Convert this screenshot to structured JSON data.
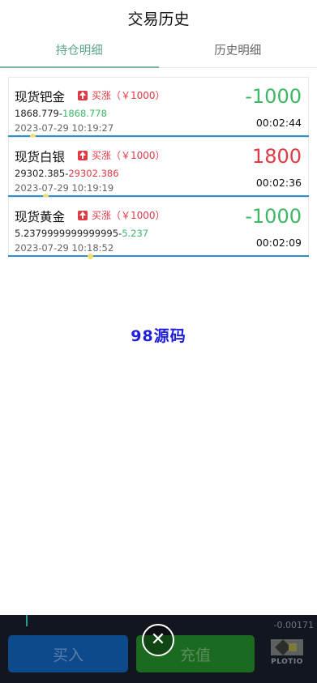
{
  "header": {
    "title": "交易历史"
  },
  "tabs": [
    {
      "label": "持仓明细",
      "active": true
    },
    {
      "label": "历史明细",
      "active": false
    }
  ],
  "trades": [
    {
      "name": "现货钯金",
      "badge": "买涨（￥1000）",
      "open_price": "1868.779-",
      "current_price": "1868.778",
      "current_color": "green",
      "time": "2023-07-29 10:19:27",
      "pl": "-1000",
      "pl_color": "green",
      "duration": "00:02:44"
    },
    {
      "name": "现货白银",
      "badge": "买涨（￥1000）",
      "open_price": "29302.385-",
      "current_price": "29302.386",
      "current_color": "red",
      "time": "2023-07-29 10:19:19",
      "pl": "1800",
      "pl_color": "red",
      "duration": "00:02:36"
    },
    {
      "name": "现货黄金",
      "badge": "买涨（￥1000）",
      "open_price": "5.2379999999999995-",
      "current_price": "5.237",
      "current_color": "green",
      "time": "2023-07-29 10:18:52",
      "pl": "-1000",
      "pl_color": "green",
      "duration": "00:02:09"
    }
  ],
  "watermark": "98源码",
  "footer": {
    "ticker": "-0.00171",
    "buy_label": "买入",
    "recharge_label": "充值",
    "close_glyph": "✕",
    "logo_text": "PLOTIO"
  },
  "colors": {
    "accent": "#5aa58a",
    "up": "#e03a45",
    "down": "#3cb764",
    "progress": "#2a8fd6"
  }
}
